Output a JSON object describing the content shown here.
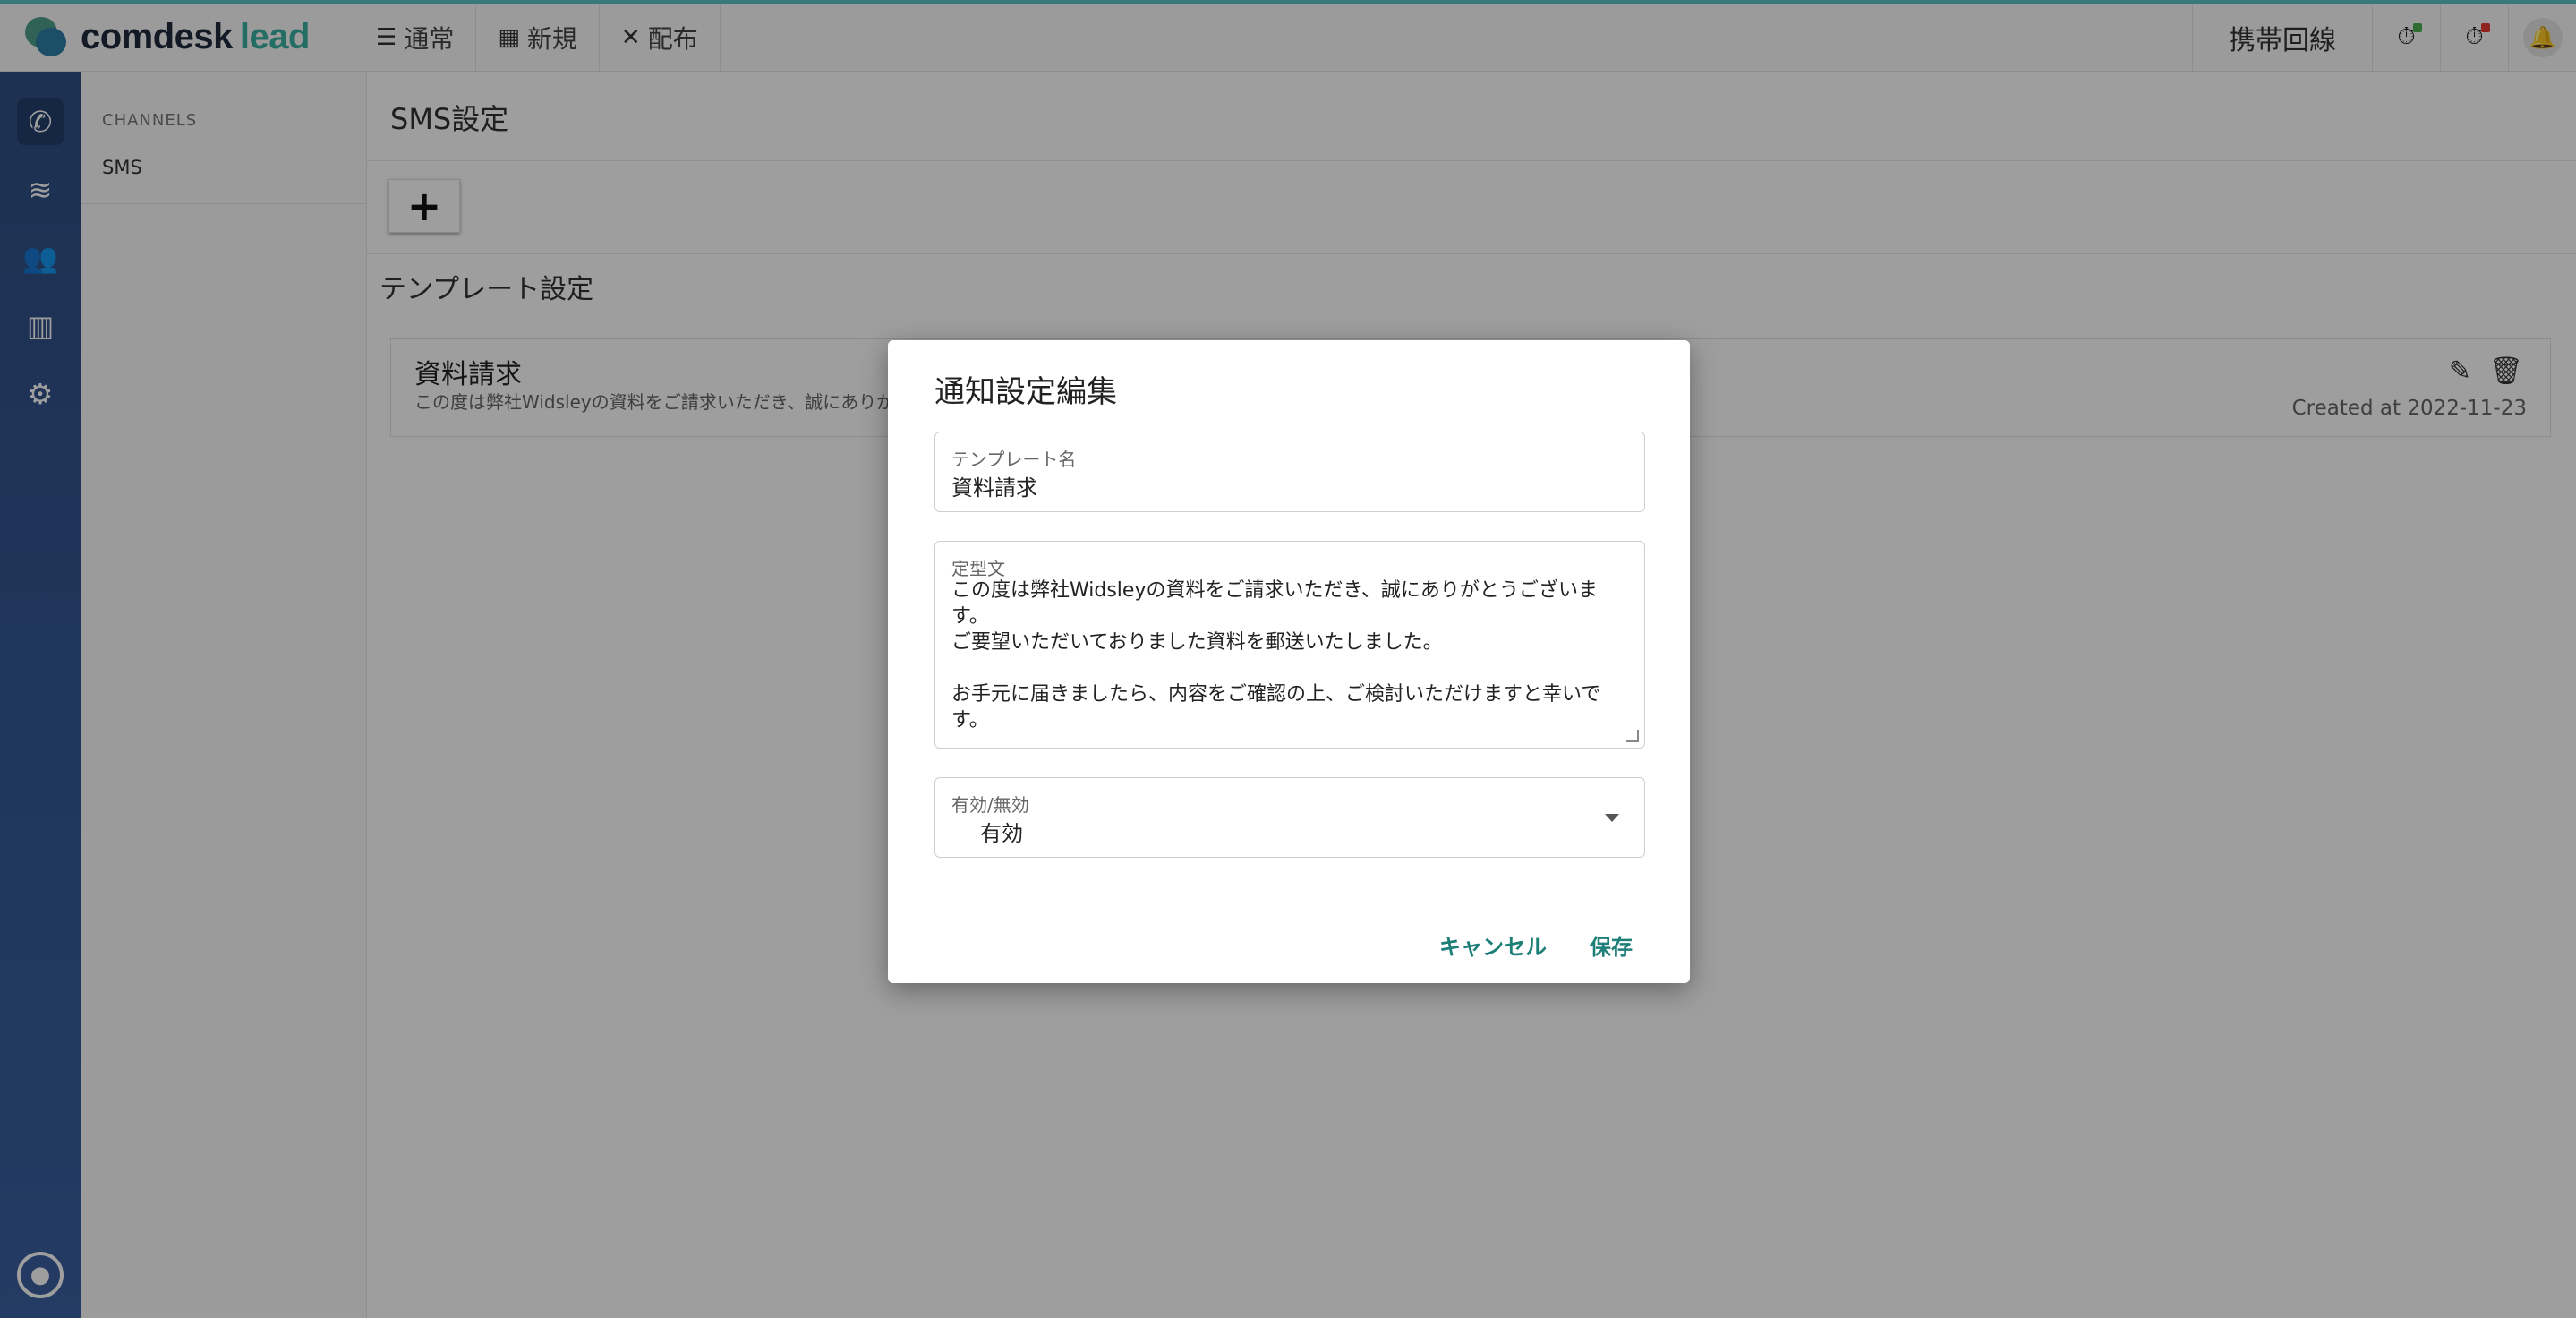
{
  "header": {
    "logo": {
      "part1": "comdesk",
      "part2": "lead"
    },
    "tabs": [
      {
        "icon": "list-icon",
        "label": "通常"
      },
      {
        "icon": "grid-icon",
        "label": "新規"
      },
      {
        "icon": "expand-icon",
        "label": "配布"
      }
    ],
    "phone_line": "携帯回線",
    "timer_badges": [
      {
        "icon": "timer-icon",
        "color": "#4caf50"
      },
      {
        "icon": "timer-icon",
        "color": "#e53935"
      }
    ],
    "notification_icon": "bell-icon"
  },
  "rail": {
    "items": [
      {
        "icon": "phone-icon",
        "active": true
      },
      {
        "icon": "database-icon",
        "active": false
      },
      {
        "icon": "users-icon",
        "active": false
      },
      {
        "icon": "chart-icon",
        "active": false
      },
      {
        "icon": "gear-icon",
        "active": false
      }
    ],
    "account_icon": "account-icon"
  },
  "channels": {
    "heading": "CHANNELS",
    "items": [
      "SMS"
    ]
  },
  "main": {
    "title": "SMS設定",
    "add_label": "+",
    "section_title": "テンプレート設定",
    "templates": [
      {
        "name": "資料請求",
        "preview": "この度は弊社Widsleyの資料をご請求いただき、誠にありが",
        "created": "Created at 2022-11-23"
      }
    ]
  },
  "dialog": {
    "title": "通知設定編集",
    "name_label": "テンプレート名",
    "name_value": "資料請求",
    "body_label": "定型文",
    "body_value": "この度は弊社Widsleyの資料をご請求いただき、誠にありがとうございます。\nご要望いただいておりました資料を郵送いたしました。\n\nお手元に届きましたら、内容をご確認の上、ご検討いただけますと幸いです。",
    "status_label": "有効/無効",
    "status_value": "有効",
    "cancel_label": "キャンセル",
    "save_label": "保存"
  },
  "colors": {
    "accent": "#1e7f78",
    "rail": "#2f4f84",
    "topbar_line": "#5cc3c8"
  }
}
